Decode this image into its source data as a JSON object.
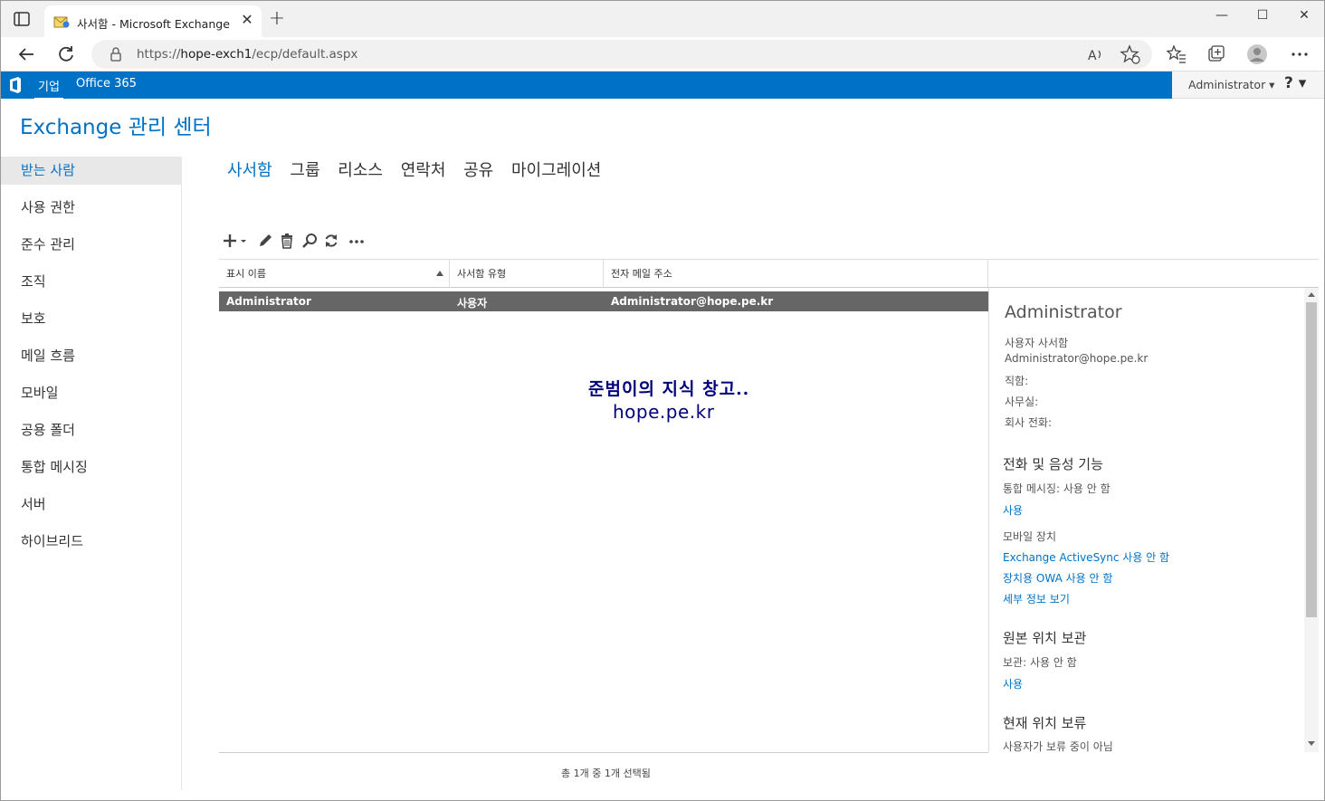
{
  "browser": {
    "tab_title": "사서함 - Microsoft Exchange",
    "tab_close": "✕",
    "new_tab": "+",
    "url_prefix": "https://",
    "url_host": "hope-exch1",
    "url_path": "/ecp/default.aspx",
    "win_min": "—",
    "win_max": "☐",
    "win_close": "✕"
  },
  "suite": {
    "enterprise": "기업",
    "office365": "Office 365",
    "user": "Administrator ▾",
    "help": "? ▾"
  },
  "app": {
    "title": "Exchange 관리 센터"
  },
  "leftnav": {
    "items": [
      {
        "label": "받는 사람"
      },
      {
        "label": "사용 권한"
      },
      {
        "label": "준수 관리"
      },
      {
        "label": "조직"
      },
      {
        "label": "보호"
      },
      {
        "label": "메일 흐름"
      },
      {
        "label": "모바일"
      },
      {
        "label": "공용 폴더"
      },
      {
        "label": "통합 메시징"
      },
      {
        "label": "서버"
      },
      {
        "label": "하이브리드"
      }
    ]
  },
  "subnav": {
    "tabs": [
      {
        "label": "사서함"
      },
      {
        "label": "그룹"
      },
      {
        "label": "리소스"
      },
      {
        "label": "연락처"
      },
      {
        "label": "공유"
      },
      {
        "label": "마이그레이션"
      }
    ]
  },
  "grid": {
    "columns": [
      "표시 이름",
      "사서함 유형",
      "전자 메일 주소"
    ],
    "rows": [
      {
        "name": "Administrator",
        "type": "사용자",
        "email": "Administrator@hope.pe.kr"
      }
    ],
    "count_text": "총 1개 중 1개 선택됨"
  },
  "watermark": {
    "line1": "준범이의 지식 창고..",
    "line2": "hope.pe.kr"
  },
  "detail": {
    "name": "Administrator",
    "mailbox_type": "사용자 사서함",
    "email": "Administrator@hope.pe.kr",
    "job_title": "직함:",
    "office": "사무실:",
    "company_phone": "회사 전화:",
    "phone_voice_header": "전화 및 음성 기능",
    "um_status": "통합 메시징:  사용 안 함",
    "um_enable": "사용",
    "mobile_devices": "모바일 장치",
    "eas_disable": "Exchange ActiveSync 사용 안 함",
    "owa_disable": "장치용 OWA 사용 안 함",
    "view_details": "세부 정보 보기",
    "archive_header": "원본 위치 보관",
    "archive_status": "보관:  사용 안 함",
    "archive_enable": "사용",
    "hold_header": "현재 위치 보류",
    "hold_status": "사용자가 보류 중이 아님"
  }
}
